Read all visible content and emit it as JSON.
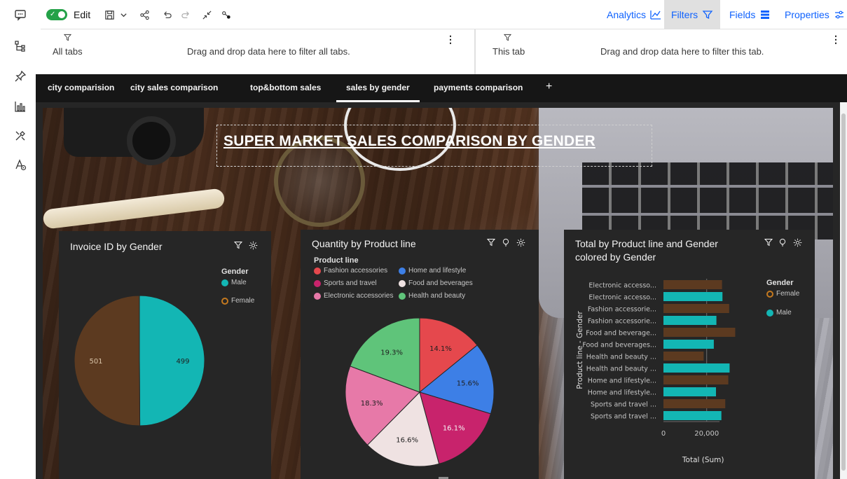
{
  "toolbar": {
    "edit_label": "Edit",
    "analytics_label": "Analytics",
    "filters_label": "Filters",
    "fields_label": "Fields",
    "properties_label": "Properties"
  },
  "filterbar": {
    "all_tabs_label": "All tabs",
    "all_tabs_drop": "Drag and drop data here to filter all tabs.",
    "this_tab_label": "This tab",
    "this_tab_drop": "Drag and drop data here to filter this tab."
  },
  "tabs": [
    {
      "label": "city comparision"
    },
    {
      "label": "city sales comparison"
    },
    {
      "label": "top&bottom sales"
    },
    {
      "label": "sales by gender"
    },
    {
      "label": "payments comparison"
    }
  ],
  "tab_add": "+",
  "dashboard": {
    "title": "SUPER MARKET SALES COMPARISON BY GENDER"
  },
  "colors": {
    "male": "#13b6b4",
    "female": "#5c3a20",
    "female_ring": "#c4791f",
    "fashion": "#e5484d",
    "home": "#3d7fe6",
    "sports": "#c8236c",
    "food": "#efe2e2",
    "electronic": "#e779a8",
    "health": "#5fc47a"
  },
  "widget_gender": {
    "title": "Invoice ID by Gender",
    "legend_title": "Gender",
    "legend": [
      "Male",
      "Female"
    ],
    "chart_data": {
      "type": "pie",
      "labels": [
        "Male",
        "Female"
      ],
      "values": [
        499,
        501
      ],
      "data_labels": [
        "499",
        "501"
      ]
    }
  },
  "widget_quantity": {
    "title": "Quantity by Product line",
    "legend_title": "Product line",
    "legend": [
      "Fashion accessories",
      "Home and lifestyle",
      "Sports and travel",
      "Food and beverages",
      "Electronic accessories",
      "Health and beauty"
    ],
    "chart_data": {
      "type": "pie",
      "labels": [
        "Fashion accessories",
        "Home and lifestyle",
        "Sports and travel",
        "Food and beverages",
        "Electronic accessories",
        "Health and beauty"
      ],
      "values": [
        14.1,
        15.6,
        16.1,
        16.6,
        18.3,
        19.3
      ],
      "data_labels": [
        "14.1%",
        "15.6%",
        "16.1%",
        "16.6%",
        "18.3%",
        "19.3%"
      ]
    }
  },
  "widget_total": {
    "title_line1": "Total by Product line and Gender",
    "title_line2": "colored by Gender",
    "legend_title": "Gender",
    "legend": [
      "Female",
      "Male"
    ],
    "y_axis_title": "Product line - Gender",
    "x_axis_title": "Total (Sum)",
    "x_ticks": [
      "0",
      "20,000"
    ],
    "chart_data": {
      "type": "bar",
      "orientation": "horizontal",
      "categories": [
        "Electronic accesso...",
        "Electronic accesso...",
        "Fashion accessorie...",
        "Fashion accessorie...",
        "Food and beverage...",
        "Food and beverages...",
        "Health and beauty ...",
        "Health and beauty ...",
        "Home and lifestyle...",
        "Home and lifestyle...",
        "Sports and travel ...",
        "Sports and travel ..."
      ],
      "genders": [
        "Female",
        "Male",
        "Female",
        "Male",
        "Female",
        "Male",
        "Female",
        "Male",
        "Female",
        "Male",
        "Female",
        "Male"
      ],
      "values": [
        27100,
        27300,
        30400,
        24500,
        33200,
        23300,
        18600,
        30600,
        30000,
        24300,
        28600,
        26800
      ],
      "xlim": [
        0,
        35000
      ]
    }
  }
}
